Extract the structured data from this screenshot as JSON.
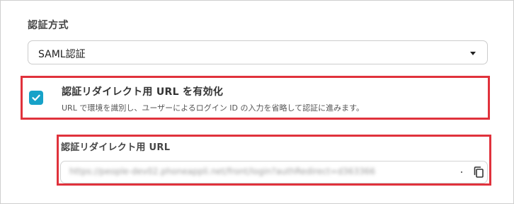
{
  "auth_method": {
    "label": "認証方式",
    "selected": "SAML認証"
  },
  "redirect_option": {
    "checked": true,
    "title": "認証リダイレクト用 URL を有効化",
    "description": "URL で環境を識別し、ユーザーによるログイン ID の入力を省略して認証に進みます。"
  },
  "redirect_url": {
    "label": "認証リダイレクト用 URL",
    "value": "https://people-dev02.phoneappli.net/front/login?authRedirect=d363366"
  },
  "icons": {
    "select_caret": "caret-down-icon",
    "checkbox": "check-icon",
    "copy": "copy-icon"
  },
  "colors": {
    "accent": "#17a2c8",
    "highlight": "#e0323c"
  }
}
